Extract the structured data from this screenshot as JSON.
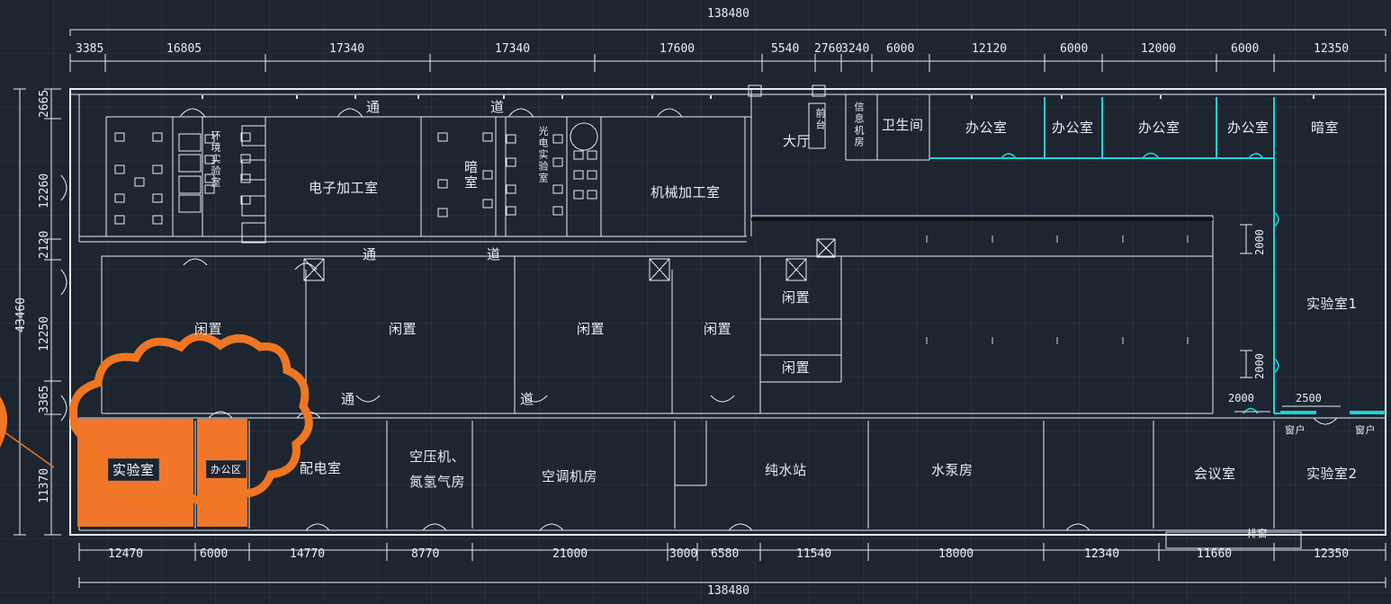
{
  "meta": {
    "drawing_type": "architectural-floor-plan",
    "background_color": "#1d2531",
    "line_color": "#e9edf2",
    "accent_cyan": "#17d6d6",
    "accent_orange": "#ef7622",
    "highlight_fill": "#f2762a"
  },
  "dimensions": {
    "overall_top": "138480",
    "overall_bottom": "138480",
    "overall_left": "43460",
    "top_chain": [
      "3385",
      "16805",
      "17340",
      "17340",
      "17600",
      "5540",
      "2760",
      "3240",
      "6000",
      "12120",
      "6000",
      "12000",
      "6000",
      "12350"
    ],
    "bottom_chain": [
      "12470",
      "6000",
      "14770",
      "8770",
      "21000",
      "3000",
      "6580",
      "11540",
      "18000",
      "12340",
      "11660",
      "12350"
    ],
    "left_chain": [
      "2665",
      "12260",
      "2120",
      "12250",
      "3365",
      "11370"
    ],
    "right_chain": [
      "2000",
      "2000",
      "2000",
      "2500"
    ]
  },
  "rooms": {
    "top_row": [
      {
        "label": "环境实验室",
        "orientation": "vertical"
      },
      {
        "label": "电子加工室",
        "orientation": "horizontal"
      },
      {
        "label": "暗室",
        "orientation": "vertical"
      },
      {
        "label": "光电实验室",
        "orientation": "vertical"
      },
      {
        "label": "机械加工室",
        "orientation": "horizontal"
      },
      {
        "label": "大厅",
        "orientation": "horizontal"
      },
      {
        "label": "前台",
        "orientation": "vertical",
        "boxed": true
      },
      {
        "label": "信息机房",
        "orientation": "vertical"
      },
      {
        "label": "卫生间",
        "orientation": "horizontal"
      },
      {
        "label": "办公室",
        "orientation": "horizontal"
      },
      {
        "label": "办公室",
        "orientation": "horizontal"
      },
      {
        "label": "办公室",
        "orientation": "horizontal"
      },
      {
        "label": "办公室",
        "orientation": "horizontal"
      },
      {
        "label": "暗室",
        "orientation": "horizontal"
      }
    ],
    "middle_row": [
      {
        "label": "闲置"
      },
      {
        "label": "闲置"
      },
      {
        "label": "闲置"
      },
      {
        "label": "闲置"
      },
      {
        "label": "闲置"
      },
      {
        "label": "闲置"
      },
      {
        "label": "实验室1"
      }
    ],
    "bottom_row": [
      {
        "label": "实验室",
        "highlighted": true
      },
      {
        "label": "办公区",
        "highlighted": true
      },
      {
        "label": "配电室"
      },
      {
        "label": "空压机、",
        "label2": "氮氢气房"
      },
      {
        "label": "空调机房"
      },
      {
        "label": "纯水站"
      },
      {
        "label": "水泵房"
      },
      {
        "label": "会议室"
      },
      {
        "label": "实验室2"
      }
    ],
    "corridor_labels": [
      "通",
      "道",
      "通",
      "道",
      "通",
      "道"
    ],
    "windows": [
      "窗户",
      "窗户"
    ],
    "vent_label": "排窗"
  },
  "annotation": {
    "type": "revision-cloud",
    "color": "#ef7622",
    "contains": [
      "实验室",
      "办公区"
    ]
  }
}
